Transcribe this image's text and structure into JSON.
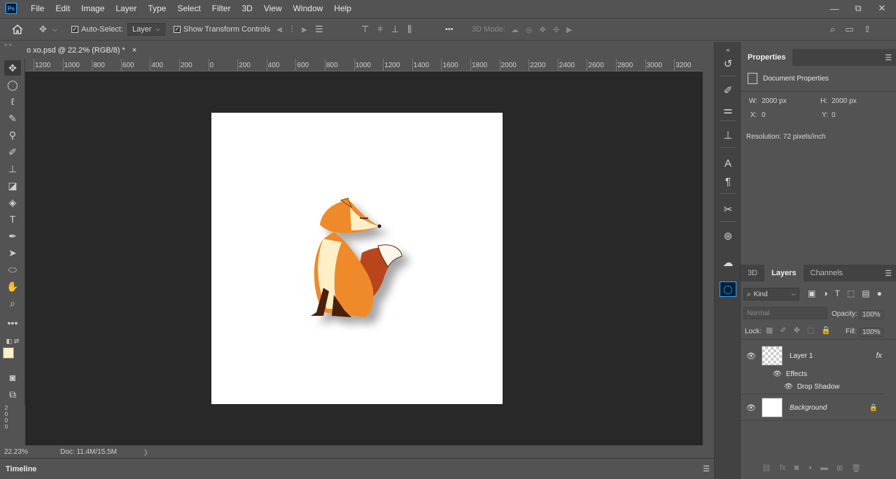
{
  "app": {
    "logo": "Ps"
  },
  "menu": [
    "File",
    "Edit",
    "Image",
    "Layer",
    "Type",
    "Select",
    "Filter",
    "3D",
    "View",
    "Window",
    "Help"
  ],
  "window_controls": {
    "minimize": "—",
    "restore": "⧉",
    "close": "✕"
  },
  "options": {
    "auto_select_label": "Auto-Select:",
    "auto_select_value": "Layer",
    "transform_label": "Show Transform Controls",
    "more": "•••",
    "mode_3d_label": "3D Mode:"
  },
  "document_tab": {
    "title": "o xo.psd @ 22.2% (RGB/8) *",
    "close": "×"
  },
  "ruler": {
    "top_labels": [
      "1200",
      "1000",
      "800",
      "600",
      "400",
      "200",
      "0",
      "200",
      "400",
      "600",
      "800",
      "1000",
      "1200",
      "1400",
      "1600",
      "1800",
      "2000",
      "2200",
      "2400",
      "2600",
      "2800",
      "3000",
      "3200"
    ],
    "left_labels": [
      "2",
      "0",
      "0",
      "0"
    ]
  },
  "status": {
    "zoom": "22.23%",
    "doc_size": "Doc: 11.4M/15.5M",
    "arrow": "〉"
  },
  "timeline": {
    "label": "Timeline"
  },
  "colors": {
    "foreground": "#fff1c5",
    "background": "#f0a030",
    "canvas_bg": "#282828",
    "ui_bg": "#535353"
  },
  "properties": {
    "tab": "Properties",
    "section": "Document Properties",
    "width_label": "W:",
    "width_value": "2000 px",
    "height_label": "H:",
    "height_value": "2000 px",
    "x_label": "X:",
    "x_value": "0",
    "y_label": "Y:",
    "y_value": "0",
    "resolution": "Resolution: 72 pixels/inch"
  },
  "layers_panel": {
    "tabs": [
      "3D",
      "Layers",
      "Channels"
    ],
    "filter_kind": "Kind",
    "blend_mode": "Normal",
    "opacity_label": "Opacity:",
    "opacity_value": "100%",
    "lock_label": "Lock:",
    "fill_label": "Fill:",
    "fill_value": "100%",
    "layers": [
      {
        "name": "Layer 1",
        "fx": "fx",
        "effects_label": "Effects",
        "effect": "Drop Shadow"
      },
      {
        "name": "Background"
      }
    ]
  }
}
